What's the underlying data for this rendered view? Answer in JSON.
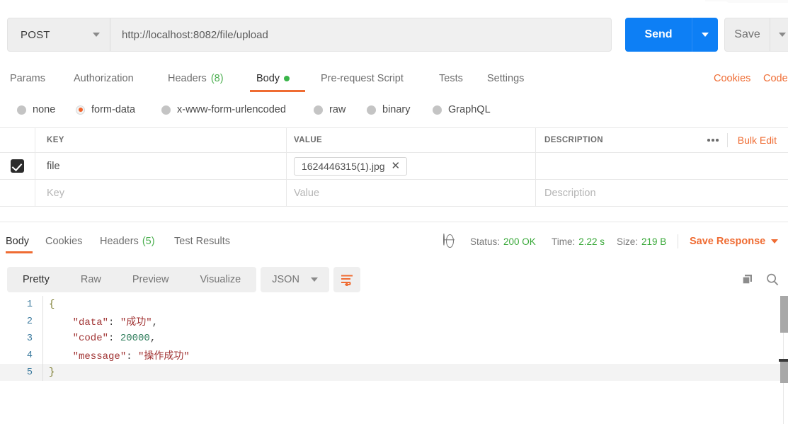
{
  "request": {
    "method": "POST",
    "url": "http://localhost:8082/file/upload",
    "send_label": "Send",
    "save_label": "Save",
    "tabs": [
      {
        "label": "Params",
        "count": "",
        "active": false,
        "dot": false
      },
      {
        "label": "Authorization",
        "count": "",
        "active": false,
        "dot": false
      },
      {
        "label": "Headers",
        "count": "(8)",
        "active": false,
        "dot": false
      },
      {
        "label": "Body",
        "count": "",
        "active": true,
        "dot": true
      },
      {
        "label": "Pre-request Script",
        "count": "",
        "active": false,
        "dot": false
      },
      {
        "label": "Tests",
        "count": "",
        "active": false,
        "dot": false
      },
      {
        "label": "Settings",
        "count": "",
        "active": false,
        "dot": false
      }
    ],
    "links": [
      {
        "label": "Cookies"
      },
      {
        "label": "Code"
      }
    ],
    "body_types": [
      {
        "label": "none",
        "selected": false
      },
      {
        "label": "form-data",
        "selected": true
      },
      {
        "label": "x-www-form-urlencoded",
        "selected": false
      },
      {
        "label": "raw",
        "selected": false
      },
      {
        "label": "binary",
        "selected": false
      },
      {
        "label": "GraphQL",
        "selected": false
      }
    ],
    "table": {
      "headers": {
        "key": "KEY",
        "value": "VALUE",
        "description": "DESCRIPTION"
      },
      "bulk_edit_label": "Bulk Edit",
      "rows": [
        {
          "checked": true,
          "key": "file",
          "value_file": "1624446315(1).jpg",
          "description": ""
        }
      ],
      "placeholders": {
        "key": "Key",
        "value": "Value",
        "description": "Description"
      }
    }
  },
  "response": {
    "tabs": [
      {
        "label": "Body",
        "count": "",
        "active": true
      },
      {
        "label": "Cookies",
        "count": "",
        "active": false
      },
      {
        "label": "Headers",
        "count": "(5)",
        "active": false
      },
      {
        "label": "Test Results",
        "count": "",
        "active": false
      }
    ],
    "meta": {
      "status_label": "Status:",
      "status_value": "200 OK",
      "time_label": "Time:",
      "time_value": "2.22 s",
      "size_label": "Size:",
      "size_value": "219 B"
    },
    "save_response_label": "Save Response",
    "format_tabs": [
      {
        "label": "Pretty",
        "active": true
      },
      {
        "label": "Raw",
        "active": false
      },
      {
        "label": "Preview",
        "active": false
      },
      {
        "label": "Visualize",
        "active": false
      }
    ],
    "language": "JSON",
    "code": {
      "lines": [
        {
          "no": "1",
          "segments": [
            {
              "t": "{",
              "c": "brace"
            }
          ]
        },
        {
          "no": "2",
          "segments": [
            {
              "t": "    \"data\"",
              "c": "key"
            },
            {
              "t": ": ",
              "c": "punc"
            },
            {
              "t": "\"成功\"",
              "c": "str"
            },
            {
              "t": ",",
              "c": "punc"
            }
          ]
        },
        {
          "no": "3",
          "segments": [
            {
              "t": "    \"code\"",
              "c": "key"
            },
            {
              "t": ": ",
              "c": "punc"
            },
            {
              "t": "20000",
              "c": "num"
            },
            {
              "t": ",",
              "c": "punc"
            }
          ]
        },
        {
          "no": "4",
          "segments": [
            {
              "t": "    \"message\"",
              "c": "key"
            },
            {
              "t": ": ",
              "c": "punc"
            },
            {
              "t": "\"操作成功\"",
              "c": "str"
            }
          ]
        },
        {
          "no": "5",
          "segments": [
            {
              "t": "}",
              "c": "brace"
            }
          ]
        }
      ]
    }
  },
  "colors": {
    "accent_orange": "#ef6c33",
    "send_blue": "#0d7ff5",
    "status_green": "#3aa93a",
    "count_green": "#4caf50"
  }
}
